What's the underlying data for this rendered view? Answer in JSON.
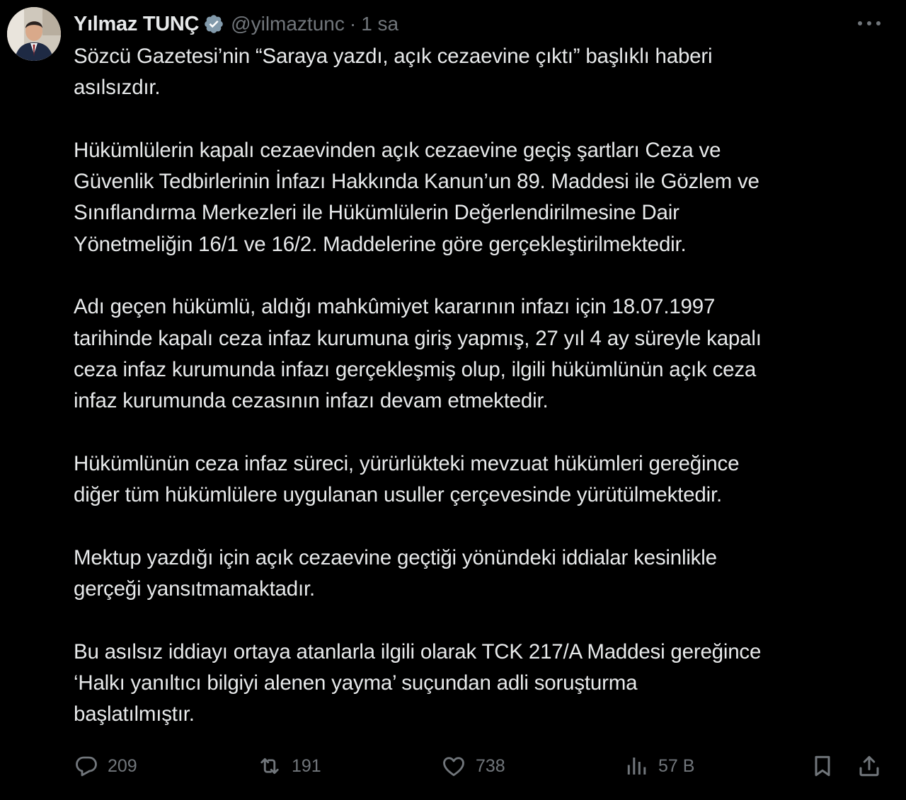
{
  "author": {
    "display_name": "Yılmaz TUNÇ",
    "handle": "@yilmaztunc",
    "separator": "·",
    "time": "1 sa",
    "verified_icon": "verified-badge-icon",
    "badge_color": "#829aab"
  },
  "tweet": {
    "paragraphs": [
      "Sözcü Gazetesi’nin “Saraya yazdı, açık cezaevine çıktı” başlıklı haberi\nasılsızdır.",
      "Hükümlülerin kapalı cezaevinden açık cezaevine geçiş şartları Ceza ve\nGüvenlik Tedbirlerinin İnfazı Hakkında Kanun’un 89. Maddesi ile Gözlem ve\nSınıflandırma Merkezleri ile Hükümlülerin Değerlendirilmesine Dair\nYönetmeliğin 16/1 ve 16/2. Maddelerine göre gerçekleştirilmektedir.",
      "Adı geçen hükümlü, aldığı mahkûmiyet kararının infazı için 18.07.1997\ntarihinde kapalı ceza infaz kurumuna giriş yapmış, 27 yıl 4 ay süreyle kapalı\nceza infaz kurumunda infazı gerçekleşmiş olup, ilgili hükümlünün açık ceza\ninfaz kurumunda cezasının infazı devam etmektedir.",
      "Hükümlünün ceza infaz süreci, yürürlükteki mevzuat hükümleri gereğince\ndiğer tüm hükümlülere uygulanan usuller çerçevesinde yürütülmektedir.",
      "Mektup yazdığı için açık cezaevine geçtiği yönündeki iddialar kesinlikle\ngerçeği yansıtmamaktadır.",
      "Bu asılsız iddiayı ortaya atanlarla ilgili olarak TCK 217/A Maddesi gereğince\n‘Halkı yanıltıcı bilgiyi alenen yayma’ suçundan adli soruşturma\nbaşlatılmıştır."
    ]
  },
  "actions": {
    "reply": {
      "icon": "reply-icon",
      "count": "209"
    },
    "retweet": {
      "icon": "retweet-icon",
      "count": "191"
    },
    "like": {
      "icon": "heart-icon",
      "count": "738"
    },
    "views": {
      "icon": "views-chart-icon",
      "count": "57 B"
    },
    "bookmark": {
      "icon": "bookmark-icon"
    },
    "share": {
      "icon": "share-icon"
    }
  },
  "menu": {
    "icon": "more-options-icon"
  },
  "colors": {
    "background": "#000000",
    "text": "#e7e9ea",
    "secondary_text": "#71767b"
  }
}
